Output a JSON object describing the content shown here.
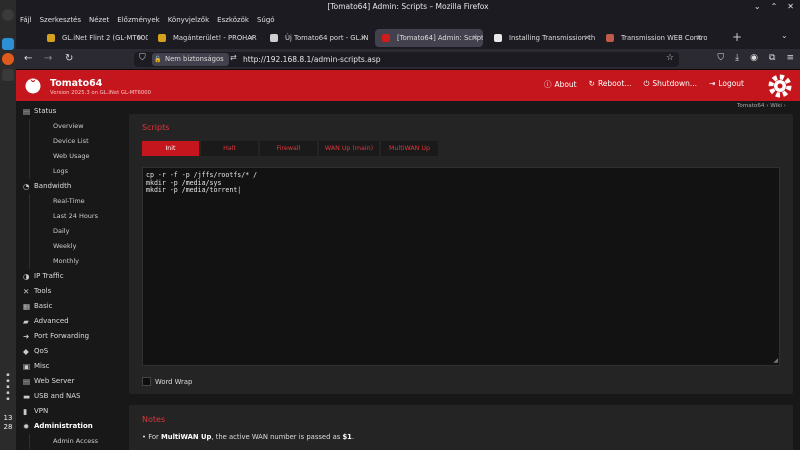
{
  "window": {
    "title": "[Tomato64] Admin: Scripts – Mozilla Firefox"
  },
  "menubar": [
    "Fájl",
    "Szerkesztés",
    "Nézet",
    "Előzmények",
    "Könyvjelzők",
    "Eszközök",
    "Súgó"
  ],
  "tabs": [
    {
      "label": "GL.iNet Flint 2 (GL-MT600",
      "favicon_color": "#d6a21d",
      "active": false
    },
    {
      "label": "Magánterület! - PROHAR",
      "favicon_color": "#d6a21d",
      "active": false
    },
    {
      "label": "Új Tomato64 port - GL.iN",
      "favicon_color": "#cfcfcf",
      "active": false
    },
    {
      "label": "[Tomato64] Admin: Script",
      "favicon_color": "#d11a1a",
      "active": true
    },
    {
      "label": "Installing Transmission th",
      "favicon_color": "#e8e8e8",
      "active": false
    },
    {
      "label": "Transmission WEB Contro",
      "favicon_color": "#c05a4a",
      "active": false
    }
  ],
  "urlbar": {
    "security": "Nem biztonságos",
    "url": "http://192.168.8.1/admin-scripts.asp"
  },
  "header": {
    "brand": "Tomato64",
    "version": "Version 2025.3 on GL.iNet GL-MT6000",
    "about": "About",
    "reboot": "Reboot...",
    "shutdown": "Shutdown...",
    "logout": "Logout",
    "breadcrumb": "Tomato64 › Wiki › "
  },
  "sidenav": [
    {
      "type": "sec",
      "label": "Status",
      "icon": "▤",
      "active": false
    },
    {
      "type": "sub",
      "label": "Overview"
    },
    {
      "type": "sub",
      "label": "Device List"
    },
    {
      "type": "sub",
      "label": "Web Usage"
    },
    {
      "type": "sub",
      "label": "Logs"
    },
    {
      "type": "sec",
      "label": "Bandwidth",
      "icon": "◔",
      "active": false
    },
    {
      "type": "sub",
      "label": "Real-Time"
    },
    {
      "type": "sub",
      "label": "Last 24 Hours"
    },
    {
      "type": "sub",
      "label": "Daily"
    },
    {
      "type": "sub",
      "label": "Weekly"
    },
    {
      "type": "sub",
      "label": "Monthly"
    },
    {
      "type": "sec",
      "label": "IP Traffic",
      "icon": "◑",
      "active": false
    },
    {
      "type": "sec",
      "label": "Tools",
      "icon": "✕",
      "active": false
    },
    {
      "type": "sec",
      "label": "Basic",
      "icon": "▦",
      "active": false
    },
    {
      "type": "sec",
      "label": "Advanced",
      "icon": "▰",
      "active": false
    },
    {
      "type": "sec",
      "label": "Port Forwarding",
      "icon": "➜",
      "active": false
    },
    {
      "type": "sec",
      "label": "QoS",
      "icon": "◆",
      "active": false
    },
    {
      "type": "sec",
      "label": "Misc",
      "icon": "▣",
      "active": false
    },
    {
      "type": "sec",
      "label": "Web Server",
      "icon": "▤",
      "active": false
    },
    {
      "type": "sec",
      "label": "USB and NAS",
      "icon": "▬",
      "active": false
    },
    {
      "type": "sec",
      "label": "VPN",
      "icon": "▮",
      "active": false
    },
    {
      "type": "sec",
      "label": "Administration",
      "icon": "✹",
      "active": true
    },
    {
      "type": "sub",
      "label": "Admin Access"
    }
  ],
  "scripts": {
    "title": "Scripts",
    "tabs": [
      {
        "label": "Init",
        "active": true
      },
      {
        "label": "Halt",
        "active": false
      },
      {
        "label": "Firewall",
        "active": false
      },
      {
        "label": "WAN Up (main)",
        "active": false
      },
      {
        "label": "MultiWAN Up",
        "active": false
      }
    ],
    "script_text": "cp -r -f -p /jffs/rootfs/* /\nmkdir -p /media/sys\nmkdir -p /media/torrent|",
    "word_wrap_label": "Word Wrap"
  },
  "notes": {
    "title": "Notes",
    "bullet": "•",
    "text_pre": "For ",
    "text_bold": "MultiWAN Up",
    "text_mid": ", the active WAN number is passed as ",
    "text_bold2": "$1",
    "text_end": "."
  },
  "osdock": {
    "clock_hour": "13",
    "clock_min": "28"
  },
  "colors": {
    "accent": "#c4161c",
    "accent_text": "#e0363c"
  }
}
